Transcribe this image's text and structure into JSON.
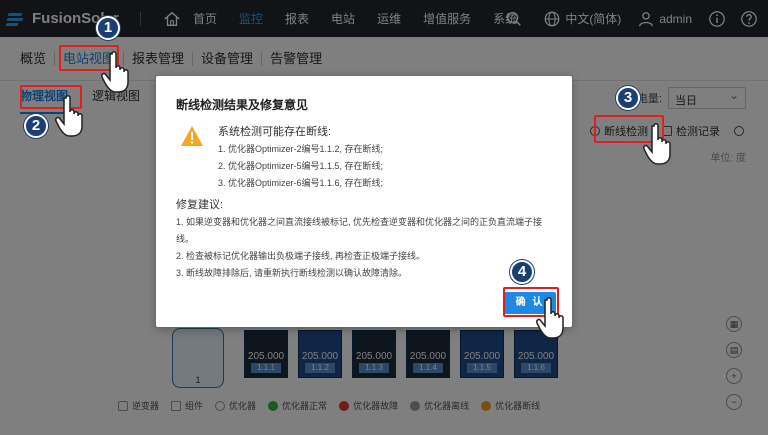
{
  "app": {
    "title": "FusionSolar"
  },
  "topnav": {
    "items": [
      "首页",
      "监控",
      "报表",
      "电站",
      "运维",
      "增值服务",
      "系统"
    ],
    "active": "监控",
    "language": "中文(简体)",
    "user": "admin"
  },
  "subnav": {
    "items": [
      "概览",
      "电站视图",
      "报表管理",
      "设备管理",
      "告警管理"
    ],
    "active": "电站视图"
  },
  "content": {
    "view_tabs": [
      "物理视图",
      "逻辑视图"
    ],
    "energy_label": "电量:",
    "period_select": "当日",
    "tools": {
      "detect": "断线检测",
      "record": "检测记录"
    },
    "unit": "单位: 度"
  },
  "diagram": {
    "inverter_number": "1",
    "panels": [
      {
        "value": "205.000",
        "id": "1.1.1"
      },
      {
        "value": "205.000",
        "id": "1.1.2"
      },
      {
        "value": "205.000",
        "id": "1.1.3"
      },
      {
        "value": "205.000",
        "id": "1.1.4"
      },
      {
        "value": "205.000",
        "id": "1.1.5"
      },
      {
        "value": "205.000",
        "id": "1.1.6"
      }
    ],
    "legend": [
      "逆变器",
      "组件",
      "优化器",
      "优化器正常",
      "优化器故障",
      "优化器离线",
      "优化器断线"
    ],
    "legend_colors": [
      "#888888",
      "#888888",
      "#888888",
      "#3cb043",
      "#e53935",
      "#9e9e9e",
      "#f0a020"
    ]
  },
  "modal": {
    "title": "断线检测结果及修复意见",
    "detect_title": "系统检测可能存在断线:",
    "detect_items": [
      "1. 优化器Optimizer-2编号1.1.2, 存在断线;",
      "2. 优化器Optimizer-5编号1.1.5, 存在断线;",
      "3. 优化器Optimizer-6编号1.1.6, 存在断线;"
    ],
    "suggest_title": "修复建议:",
    "suggest_items": [
      "1. 如果逆变器和优化器之间直流接线被标记, 优先检查逆变器和优化器之间的正负直流端子接线。",
      "2. 检查被标记优化器输出负极端子接线, 再检查正极端子接线。",
      "3. 断线故障排除后, 请重新执行断线检测以确认故障清除。"
    ],
    "confirm": "确 认"
  },
  "annotations": [
    "1",
    "2",
    "3",
    "4"
  ]
}
